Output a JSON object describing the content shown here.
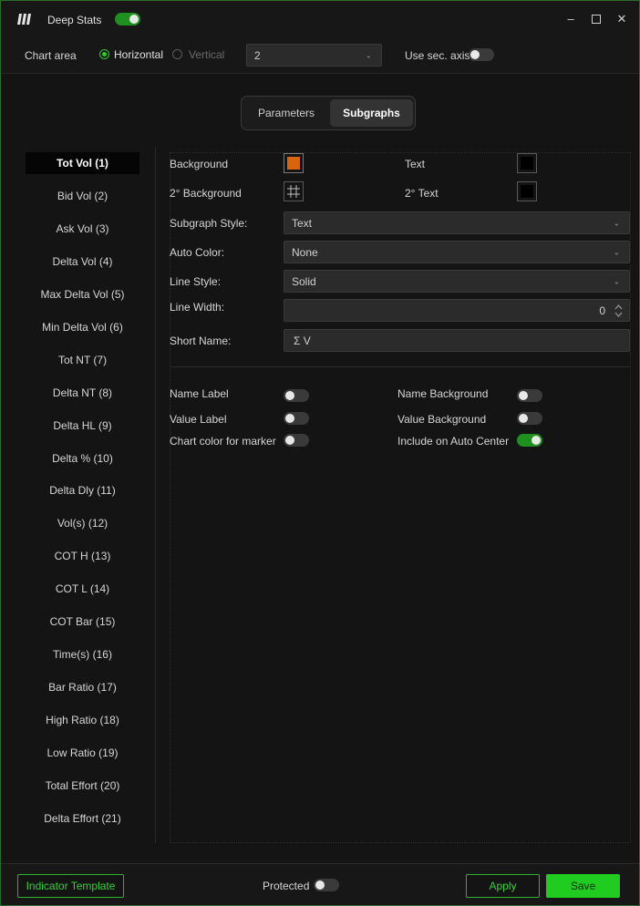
{
  "app": {
    "title": "Deep Stats",
    "enabled": true,
    "accent_color": "#1fcc1f"
  },
  "toolbar": {
    "chart_area_label": "Chart area",
    "orientation": {
      "horizontal": "Horizontal",
      "vertical": "Vertical",
      "selected": "Horizontal"
    },
    "panel_select_value": "2",
    "use_sec_axis_label": "Use sec. axis",
    "use_sec_axis": false
  },
  "tabs": {
    "parameters": "Parameters",
    "subgraphs": "Subgraphs",
    "active": "Subgraphs"
  },
  "sidebar": {
    "items": [
      "Tot Vol (1)",
      "Bid Vol (2)",
      "Ask Vol (3)",
      "Delta Vol (4)",
      "Max Delta Vol (5)",
      "Min Delta Vol (6)",
      "Tot NT (7)",
      "Delta NT (8)",
      "Delta HL (9)",
      "Delta % (10)",
      "Delta Dly (11)",
      "Vol(s) (12)",
      "COT H (13)",
      "COT L (14)",
      "COT Bar (15)",
      "Time(s) (16)",
      "Bar Ratio (17)",
      "High Ratio (18)",
      "Low Ratio (19)",
      "Total Effort (20)",
      "Delta Effort (21)"
    ],
    "active_index": 0
  },
  "panel": {
    "background_label": "Background",
    "background_color": "#d8650d",
    "text_label": "Text",
    "text_color": "#000000",
    "background2_label": "2° Background",
    "background2_icon": "grid-transparent-icon",
    "text2_label": "2° Text",
    "text2_color": "#000000",
    "subgraph_style_label": "Subgraph Style:",
    "subgraph_style_value": "Text",
    "auto_color_label": "Auto Color:",
    "auto_color_value": "None",
    "line_style_label": "Line Style:",
    "line_style_value": "Solid",
    "line_width_label": "Line Width:",
    "line_width_value": "0",
    "short_name_label": "Short Name:",
    "short_name_value": "Σ V",
    "toggles": {
      "name_label": "Name Label",
      "name_label_on": false,
      "value_label": "Value Label",
      "value_label_on": false,
      "chart_color_marker": "Chart color for marker",
      "chart_color_marker_on": false,
      "name_background": "Name Background",
      "name_background_on": false,
      "value_background": "Value Background",
      "value_background_on": false,
      "include_auto_center": "Include on Auto Center",
      "include_auto_center_on": true
    }
  },
  "footer": {
    "indicator_template": "Indicator Template",
    "protected_label": "Protected",
    "protected_on": false,
    "apply": "Apply",
    "save": "Save"
  }
}
